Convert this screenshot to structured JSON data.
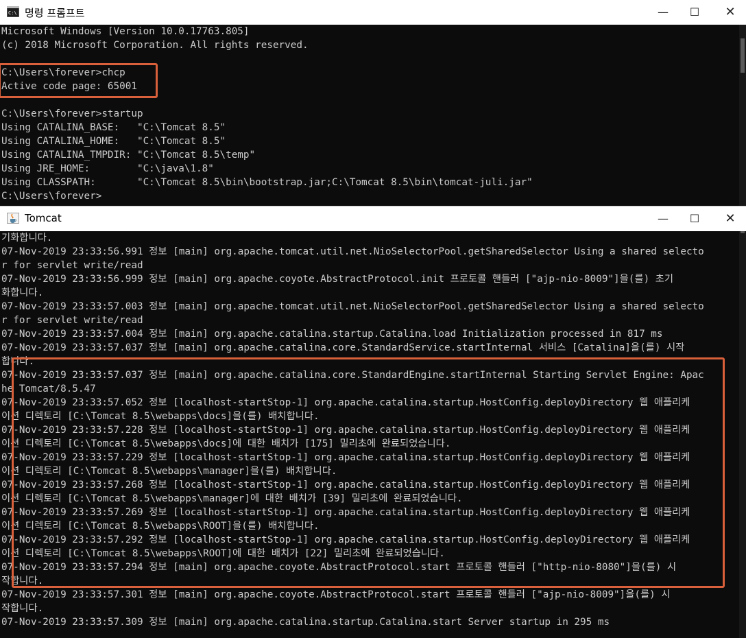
{
  "cmd_window": {
    "title": "명령 프롬프트",
    "controls": {
      "minimize": "—",
      "maximize": "☐",
      "close": "✕"
    },
    "lines": [
      "Microsoft Windows [Version 10.0.17763.805]",
      "(c) 2018 Microsoft Corporation. All rights reserved.",
      "",
      "C:\\Users\\forever>chcp",
      "Active code page: 65001",
      "",
      "C:\\Users\\forever>startup",
      "Using CATALINA_BASE:   \"C:\\Tomcat 8.5\"",
      "Using CATALINA_HOME:   \"C:\\Tomcat 8.5\"",
      "Using CATALINA_TMPDIR: \"C:\\Tomcat 8.5\\temp\"",
      "Using JRE_HOME:        \"C:\\java\\1.8\"",
      "Using CLASSPATH:       \"C:\\Tomcat 8.5\\bin\\bootstrap.jar;C:\\Tomcat 8.5\\bin\\tomcat-juli.jar\"",
      "C:\\Users\\forever>"
    ]
  },
  "tomcat_window": {
    "title": "Tomcat",
    "controls": {
      "minimize": "—",
      "maximize": "☐",
      "close": "✕"
    },
    "lines": [
      "기화합니다.",
      "07-Nov-2019 23:33:56.991 정보 [main] org.apache.tomcat.util.net.NioSelectorPool.getSharedSelector Using a shared selecto",
      "r for servlet write/read",
      "07-Nov-2019 23:33:56.999 정보 [main] org.apache.coyote.AbstractProtocol.init 프로토콜 핸들러 [\"ajp-nio-8009\"]을(를) 초기",
      "화합니다.",
      "07-Nov-2019 23:33:57.003 정보 [main] org.apache.tomcat.util.net.NioSelectorPool.getSharedSelector Using a shared selecto",
      "r for servlet write/read",
      "07-Nov-2019 23:33:57.004 정보 [main] org.apache.catalina.startup.Catalina.load Initialization processed in 817 ms",
      "07-Nov-2019 23:33:57.037 정보 [main] org.apache.catalina.core.StandardService.startInternal 서비스 [Catalina]을(를) 시작",
      "합니다.",
      "07-Nov-2019 23:33:57.037 정보 [main] org.apache.catalina.core.StandardEngine.startInternal Starting Servlet Engine: Apac",
      "he Tomcat/8.5.47",
      "07-Nov-2019 23:33:57.052 정보 [localhost-startStop-1] org.apache.catalina.startup.HostConfig.deployDirectory 웹 애플리케",
      "이션 디렉토리 [C:\\Tomcat 8.5\\webapps\\docs]을(를) 배치합니다.",
      "07-Nov-2019 23:33:57.228 정보 [localhost-startStop-1] org.apache.catalina.startup.HostConfig.deployDirectory 웹 애플리케",
      "이션 디렉토리 [C:\\Tomcat 8.5\\webapps\\docs]에 대한 배치가 [175] 밀리초에 완료되었습니다.",
      "07-Nov-2019 23:33:57.229 정보 [localhost-startStop-1] org.apache.catalina.startup.HostConfig.deployDirectory 웹 애플리케",
      "이션 디렉토리 [C:\\Tomcat 8.5\\webapps\\manager]을(를) 배치합니다.",
      "07-Nov-2019 23:33:57.268 정보 [localhost-startStop-1] org.apache.catalina.startup.HostConfig.deployDirectory 웹 애플리케",
      "이션 디렉토리 [C:\\Tomcat 8.5\\webapps\\manager]에 대한 배치가 [39] 밀리초에 완료되었습니다.",
      "07-Nov-2019 23:33:57.269 정보 [localhost-startStop-1] org.apache.catalina.startup.HostConfig.deployDirectory 웹 애플리케",
      "이션 디렉토리 [C:\\Tomcat 8.5\\webapps\\ROOT]을(를) 배치합니다.",
      "07-Nov-2019 23:33:57.292 정보 [localhost-startStop-1] org.apache.catalina.startup.HostConfig.deployDirectory 웹 애플리케",
      "이션 디렉토리 [C:\\Tomcat 8.5\\webapps\\ROOT]에 대한 배치가 [22] 밀리초에 완료되었습니다.",
      "07-Nov-2019 23:33:57.294 정보 [main] org.apache.coyote.AbstractProtocol.start 프로토콜 핸들러 [\"http-nio-8080\"]을(를) 시",
      "작합니다.",
      "07-Nov-2019 23:33:57.301 정보 [main] org.apache.coyote.AbstractProtocol.start 프로토콜 핸들러 [\"ajp-nio-8009\"]을(를) 시",
      "작합니다.",
      "07-Nov-2019 23:33:57.309 정보 [main] org.apache.catalina.startup.Catalina.start Server startup in 295 ms"
    ]
  },
  "colors": {
    "console_bg": "#0c0c0c",
    "console_text": "#cccccc",
    "highlight": "#d9603b"
  }
}
